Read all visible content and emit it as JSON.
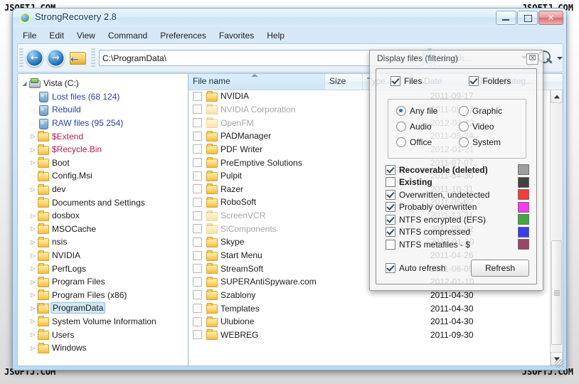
{
  "watermark": {
    "text": "JSOFTJ.COM"
  },
  "window": {
    "title": "StrongRecovery 2.8",
    "minimize_label": "–",
    "maximize_label": "❐",
    "close_label": "✕"
  },
  "menu": {
    "items": [
      "File",
      "Edit",
      "View",
      "Command",
      "Preferences",
      "Favorites",
      "Help"
    ]
  },
  "toolbar": {
    "back_label": "←",
    "forward_label": "→",
    "up_label": "←",
    "address_value": "C:\\ProgramData\\",
    "search_placeholder": "Search..."
  },
  "tree": {
    "items": [
      {
        "label": "Vista (C:)",
        "indent": 0,
        "icon": "drive-icon",
        "twisty": "◢",
        "color": "black",
        "selected": false
      },
      {
        "label": "Lost files (68 124)",
        "indent": 1,
        "icon": "recycle-bin-icon",
        "twisty": "",
        "color": "blue",
        "selected": false
      },
      {
        "label": "Rebuild",
        "indent": 1,
        "icon": "recycle-bin-icon",
        "twisty": "",
        "color": "blue",
        "selected": false
      },
      {
        "label": "RAW files (95 254)",
        "indent": 1,
        "icon": "recycle-bin-icon",
        "twisty": "",
        "color": "blue",
        "selected": false
      },
      {
        "label": "$Extend",
        "indent": 1,
        "icon": "folder-icon",
        "twisty": "▷",
        "color": "red",
        "selected": false
      },
      {
        "label": "$Recycle.Bin",
        "indent": 1,
        "icon": "folder-icon",
        "twisty": "▷",
        "color": "red",
        "selected": false
      },
      {
        "label": "Boot",
        "indent": 1,
        "icon": "folder-icon",
        "twisty": "▷",
        "color": "black",
        "selected": false
      },
      {
        "label": "Config.Msi",
        "indent": 1,
        "icon": "folder-icon",
        "twisty": "",
        "color": "black",
        "selected": false
      },
      {
        "label": "dev",
        "indent": 1,
        "icon": "folder-icon",
        "twisty": "▷",
        "color": "black",
        "selected": false
      },
      {
        "label": "Documents and Settings",
        "indent": 1,
        "icon": "folder-icon",
        "twisty": "",
        "color": "black",
        "selected": false
      },
      {
        "label": "dosbox",
        "indent": 1,
        "icon": "folder-icon",
        "twisty": "▷",
        "color": "black",
        "selected": false
      },
      {
        "label": "MSOCache",
        "indent": 1,
        "icon": "folder-icon",
        "twisty": "▷",
        "color": "black",
        "selected": false
      },
      {
        "label": "nsis",
        "indent": 1,
        "icon": "folder-icon",
        "twisty": "▷",
        "color": "black",
        "selected": false
      },
      {
        "label": "NVIDIA",
        "indent": 1,
        "icon": "folder-icon",
        "twisty": "▷",
        "color": "black",
        "selected": false
      },
      {
        "label": "PerfLogs",
        "indent": 1,
        "icon": "folder-icon",
        "twisty": "▷",
        "color": "black",
        "selected": false
      },
      {
        "label": "Program Files",
        "indent": 1,
        "icon": "folder-icon",
        "twisty": "▷",
        "color": "black",
        "selected": false
      },
      {
        "label": "Program Files (x86)",
        "indent": 1,
        "icon": "folder-icon",
        "twisty": "▷",
        "color": "black",
        "selected": false
      },
      {
        "label": "ProgramData",
        "indent": 1,
        "icon": "folder-icon",
        "twisty": "▷",
        "color": "black",
        "selected": true
      },
      {
        "label": "System Volume Information",
        "indent": 1,
        "icon": "folder-icon",
        "twisty": "▷",
        "color": "black",
        "selected": false
      },
      {
        "label": "Users",
        "indent": 1,
        "icon": "folder-icon",
        "twisty": "▷",
        "color": "black",
        "selected": false
      },
      {
        "label": "Windows",
        "indent": 1,
        "icon": "folder-icon",
        "twisty": "▷",
        "color": "black",
        "selected": false
      }
    ]
  },
  "filelist": {
    "columns": [
      "File name",
      "Size",
      "Type",
      "Date",
      "Rating (integ..."
    ],
    "rows": [
      {
        "name": "NVIDIA",
        "size": "",
        "type": "",
        "date": "2011-09-17",
        "dim": false
      },
      {
        "name": "NVIDIA Corporation",
        "size": "",
        "type": "",
        "date": "2011-09-17",
        "dim": true
      },
      {
        "name": "OpenFM",
        "size": "",
        "type": "",
        "date": "2012-01-12",
        "dim": true
      },
      {
        "name": "PADManager",
        "size": "",
        "type": "",
        "date": "2011-05-24",
        "dim": false
      },
      {
        "name": "PDF Writer",
        "size": "",
        "type": "",
        "date": "2012-01-21",
        "dim": false
      },
      {
        "name": "PreEmptive Solutions",
        "size": "",
        "type": "",
        "date": "2011-07-07",
        "dim": false
      },
      {
        "name": "Pulpit",
        "size": "",
        "type": "",
        "date": "2011-04-30",
        "dim": false
      },
      {
        "name": "Razer",
        "size": "",
        "type": "",
        "date": "2011-10-31",
        "dim": false
      },
      {
        "name": "RoboSoft",
        "size": "",
        "type": "",
        "date": "2011-05-02",
        "dim": false
      },
      {
        "name": "ScreenVCR",
        "size": "",
        "type": "",
        "date": "2011-12-31",
        "dim": true
      },
      {
        "name": "SiComponents",
        "size": "",
        "type": "",
        "date": "2011-05-02",
        "dim": true
      },
      {
        "name": "Skype",
        "size": "",
        "type": "",
        "date": "2012-01-10",
        "dim": false
      },
      {
        "name": "Start Menu",
        "size": "",
        "type": "",
        "date": "2011-04-26",
        "dim": false
      },
      {
        "name": "StreamSoft",
        "size": "",
        "type": "",
        "date": "2011-06-05",
        "dim": false
      },
      {
        "name": "SUPERAntiSpyware.com",
        "size": "",
        "type": "",
        "date": "2012-01-10",
        "dim": false
      },
      {
        "name": "Szablony",
        "size": "",
        "type": "",
        "date": "2011-04-30",
        "dim": false
      },
      {
        "name": "Templates",
        "size": "",
        "type": "",
        "date": "2011-04-30",
        "dim": false
      },
      {
        "name": "Ulubione",
        "size": "",
        "type": "",
        "date": "2011-04-30",
        "dim": false
      },
      {
        "name": "WEBREG",
        "size": "",
        "type": "",
        "date": "2011-09-30",
        "dim": false
      }
    ]
  },
  "dialog": {
    "title": "Display files (filtering)",
    "close_label": "⌧",
    "files_label": "Files",
    "files_checked": true,
    "folders_label": "Folders",
    "folders_checked": true,
    "types": [
      {
        "label": "Any file",
        "selected": true
      },
      {
        "label": "Graphic",
        "selected": false
      },
      {
        "label": "Audio",
        "selected": false
      },
      {
        "label": "Video",
        "selected": false
      },
      {
        "label": "Office",
        "selected": false
      },
      {
        "label": "System",
        "selected": false
      }
    ],
    "states": [
      {
        "label": "Recoverable (deleted)",
        "checked": true,
        "bold": true,
        "color": "#9e9e9e"
      },
      {
        "label": "Existing",
        "checked": false,
        "bold": true,
        "color": "#414141"
      },
      {
        "label": "Overwritten, undetected",
        "checked": true,
        "bold": false,
        "color": "#f53b3b"
      },
      {
        "label": "Probably overwritten",
        "checked": true,
        "bold": false,
        "color": "#f53bf0"
      },
      {
        "label": "NTFS encrypted (EFS)",
        "checked": true,
        "bold": false,
        "color": "#3fa83f"
      },
      {
        "label": "NTFS compressed",
        "checked": true,
        "bold": false,
        "color": "#3b3bf5"
      },
      {
        "label": "NTFS metafiles - $",
        "checked": false,
        "bold": false,
        "color": "#9e4466"
      }
    ],
    "auto_refresh_label": "Auto refresh",
    "auto_refresh_checked": true,
    "refresh_label": "Refresh"
  }
}
